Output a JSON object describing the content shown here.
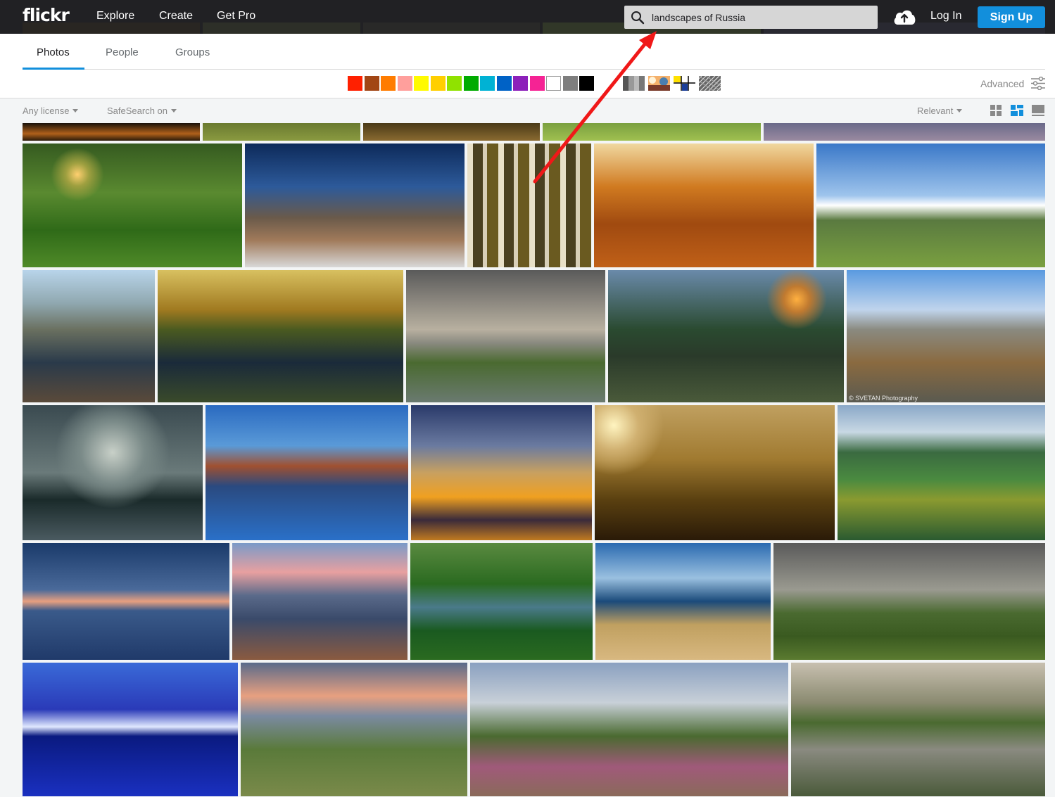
{
  "nav": {
    "logo": "flickr",
    "links": [
      "Explore",
      "Create",
      "Get Pro"
    ],
    "search_value": "landscapes of Russia",
    "login": "Log In",
    "signup": "Sign Up"
  },
  "tabs": [
    "Photos",
    "People",
    "Groups"
  ],
  "active_tab": "Photos",
  "colors": [
    "#ff2000",
    "#a24615",
    "#ff7c00",
    "#ff9f9c",
    "#fffa00",
    "#ffcf00",
    "#90e200",
    "#00ab00",
    "#00b2d4",
    "#0062c6",
    "#8c20ba",
    "#f52394",
    "#ffffff",
    "#7e7e7e",
    "#000000"
  ],
  "style_filters": [
    "black-and-white",
    "shallow-depth-of-field",
    "minimalist",
    "patterns"
  ],
  "advanced": "Advanced",
  "filters": {
    "license": "Any license",
    "safesearch": "SafeSearch on",
    "sort": "Relevant"
  },
  "views": [
    "grid-small",
    "justified",
    "large"
  ],
  "accent": "#128fdc",
  "watermarks": {
    "svetan": "© SVETAN Photography"
  }
}
